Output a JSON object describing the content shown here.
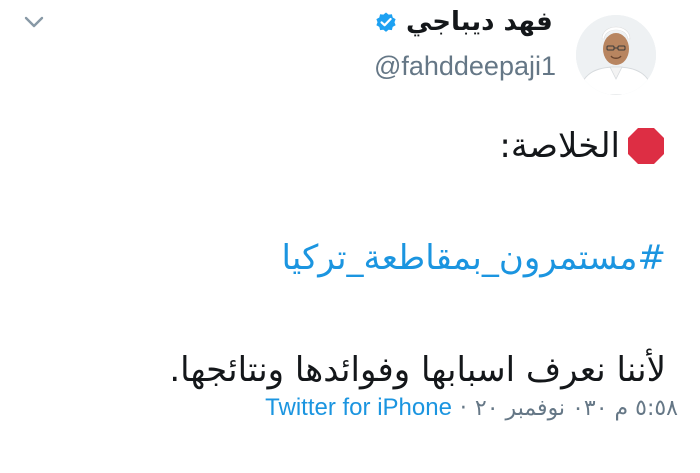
{
  "author": {
    "display_name": "فهد ديباجي",
    "handle": "@fahddeepaji1",
    "verified": true,
    "avatar": "profile-photo"
  },
  "icons": {
    "verified": "verified-badge-icon",
    "more": "chevron-down-icon",
    "stop": "stop-sign-emoji"
  },
  "tweet": {
    "line1": "الخلاصة:",
    "hashtag": "#مستمرون_بمقاطعة_تركيا",
    "line3": "لأننا نعرف اسبابها وفوائدها ونتائجها."
  },
  "footer": {
    "timestamp": "٥:٥٨ م ٠٣٠ نوفمبر ٢٠",
    "separator": "·",
    "source": "Twitter for iPhone"
  },
  "colors": {
    "link": "#1b95e0",
    "secondary": "#657786",
    "text": "#14171a",
    "stop_red": "#dd2e44"
  }
}
